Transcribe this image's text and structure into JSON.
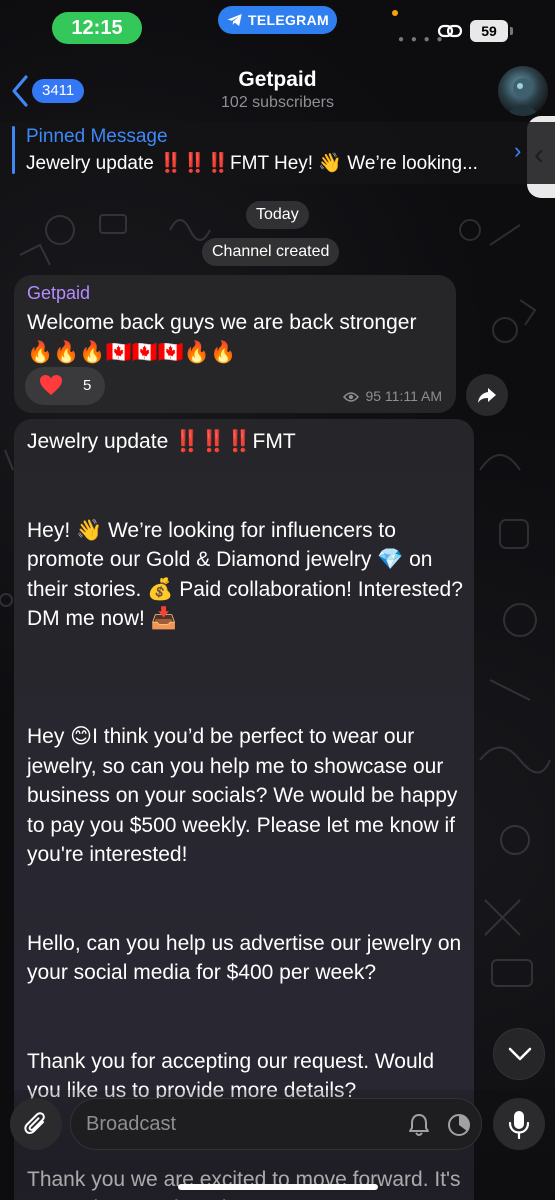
{
  "status_bar": {
    "time": "12:15",
    "app_pill": "TELEGRAM",
    "battery": "59"
  },
  "header": {
    "back_count": "3411",
    "title": "Getpaid",
    "subtitle": "102 subscribers"
  },
  "pinned": {
    "label": "Pinned Message",
    "text": "Jewelry update ‼️‼️‼️FMT Hey! 👋 We’re looking..."
  },
  "service": {
    "date": "Today",
    "event": "Channel created"
  },
  "messages": [
    {
      "sender": "Getpaid",
      "text": "Welcome back guys we are back stronger 🔥🔥🔥🇨🇦🇨🇦🇨🇦🔥🔥",
      "reaction_count": "5",
      "views": "95",
      "time": "11:11 AM"
    },
    {
      "text": "Jewelry update ‼️‼️‼️FMT\n\n\nHey! 👋 We’re looking for influencers to promote our Gold & Diamond jewelry 💎 on their stories. 💰 Paid collaboration! Interested? DM me now! 📥\n\n\n\nHey 😊I think you’d be perfect to wear our jewelry, so can you help me to showcase our business on your socials? We would be happy to pay you $500 weekly. Please let me know if you're interested!\n\n\nHello, can you help us advertise our jewelry on your social media for $400 per week?\n\n\nThank you for accepting our request. Would you like us to provide more details?\n\n\nThank you we are excited to move forward. It's a Jewelry store here in New"
    }
  ],
  "composer": {
    "placeholder": "Broadcast"
  },
  "colors": {
    "accent": "#3e88f7",
    "sender": "#b48cff",
    "time_pill": "#34c759"
  },
  "icons": [
    "back-chevron-icon",
    "telegram-icon",
    "link-icon",
    "heart-icon",
    "eye-icon",
    "share-icon",
    "chevron-down-icon",
    "paperclip-icon",
    "bell-icon",
    "timer-icon",
    "microphone-icon"
  ]
}
